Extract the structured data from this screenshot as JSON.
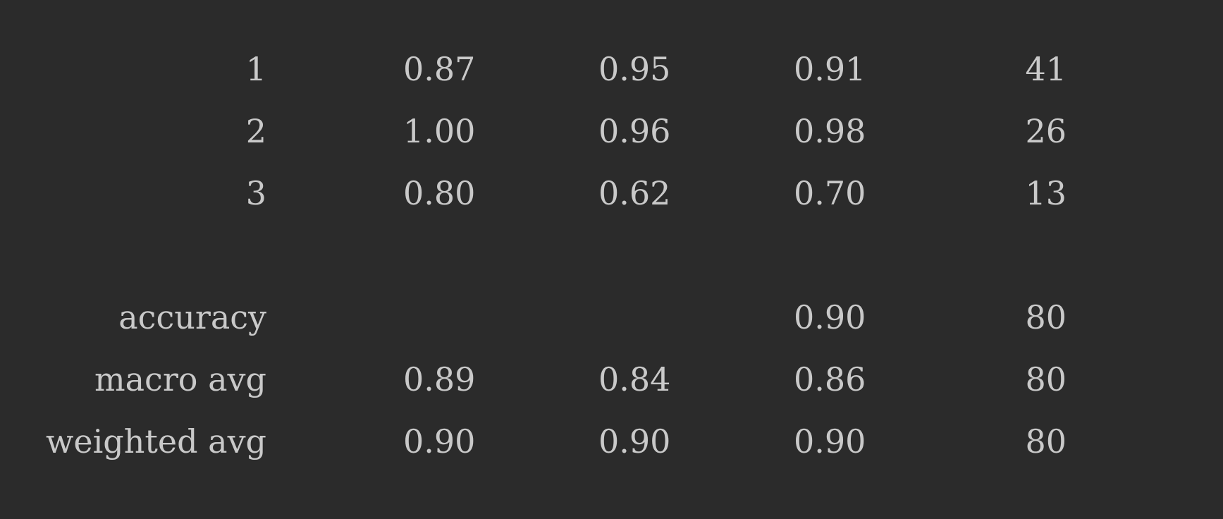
{
  "report": {
    "rows": [
      {
        "label": "1",
        "precision": "0.87",
        "recall": "0.95",
        "f1_score": "0.91",
        "support": "41"
      },
      {
        "label": "2",
        "precision": "1.00",
        "recall": "0.96",
        "f1_score": "0.98",
        "support": "26"
      },
      {
        "label": "3",
        "precision": "0.80",
        "recall": "0.62",
        "f1_score": "0.70",
        "support": "13"
      },
      {
        "label": "accuracy",
        "precision": "",
        "recall": "",
        "f1_score": "0.90",
        "support": "80"
      },
      {
        "label": "macro avg",
        "precision": "0.89",
        "recall": "0.84",
        "f1_score": "0.86",
        "support": "80"
      },
      {
        "label": "weighted avg",
        "precision": "0.90",
        "recall": "0.90",
        "f1_score": "0.90",
        "support": "80"
      }
    ]
  }
}
